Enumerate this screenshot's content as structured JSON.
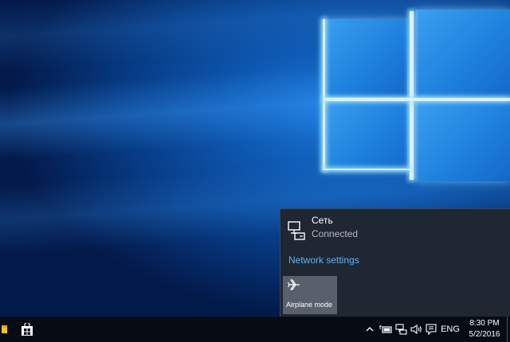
{
  "desktop": {
    "wallpaper": "windows-10-hero-wallpaper",
    "accent_color": "#1d7fdc"
  },
  "flyout": {
    "network": {
      "name": "Сеть",
      "status": "Connected",
      "icon": "wired-network-icon"
    },
    "settings_link": "Network settings",
    "settings_link_color": "#5ab4f3",
    "airplane_tile": {
      "label": "Airplane mode",
      "icon": "airplane-icon",
      "state": "off"
    }
  },
  "taskbar": {
    "pinned": [
      {
        "name": "file-explorer-icon"
      },
      {
        "name": "store-icon"
      }
    ],
    "tray": {
      "icons": [
        "chevron-up-icon",
        "battery-icon",
        "network-icon",
        "volume-icon",
        "action-center-icon"
      ],
      "language": "ENG",
      "time": "8:30 PM",
      "date": "5/2/2016"
    }
  }
}
